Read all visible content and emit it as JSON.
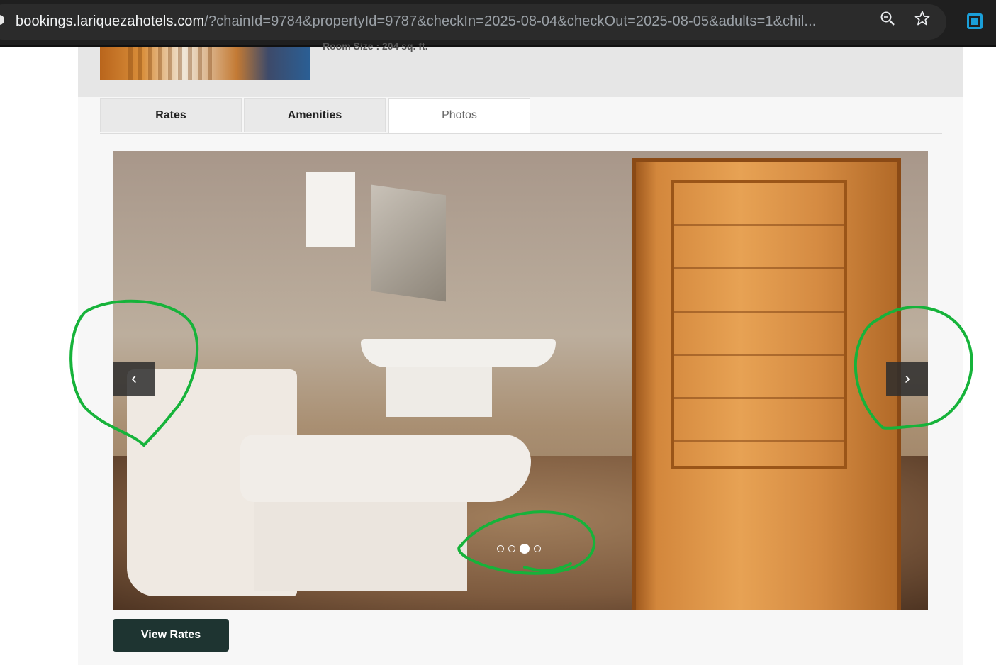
{
  "browser": {
    "url_domain": "bookings.lariquezahotels.com",
    "url_rest": "/?chainId=9784&propertyId=9787&checkIn=2025-08-04&checkOut=2025-08-05&adults=1&chil..."
  },
  "room": {
    "size_text": "Room Size : 204 sq. ft."
  },
  "tabs": [
    {
      "label": "Rates",
      "active": false
    },
    {
      "label": "Amenities",
      "active": false
    },
    {
      "label": "Photos",
      "active": true
    }
  ],
  "carousel": {
    "prev_symbol": "‹",
    "next_symbol": "›",
    "slide_count": 4,
    "active_index": 2
  },
  "actions": {
    "view_rates_label": "View Rates"
  },
  "colors": {
    "button_bg": "#1e3431",
    "annotation_green": "#16b33a"
  }
}
